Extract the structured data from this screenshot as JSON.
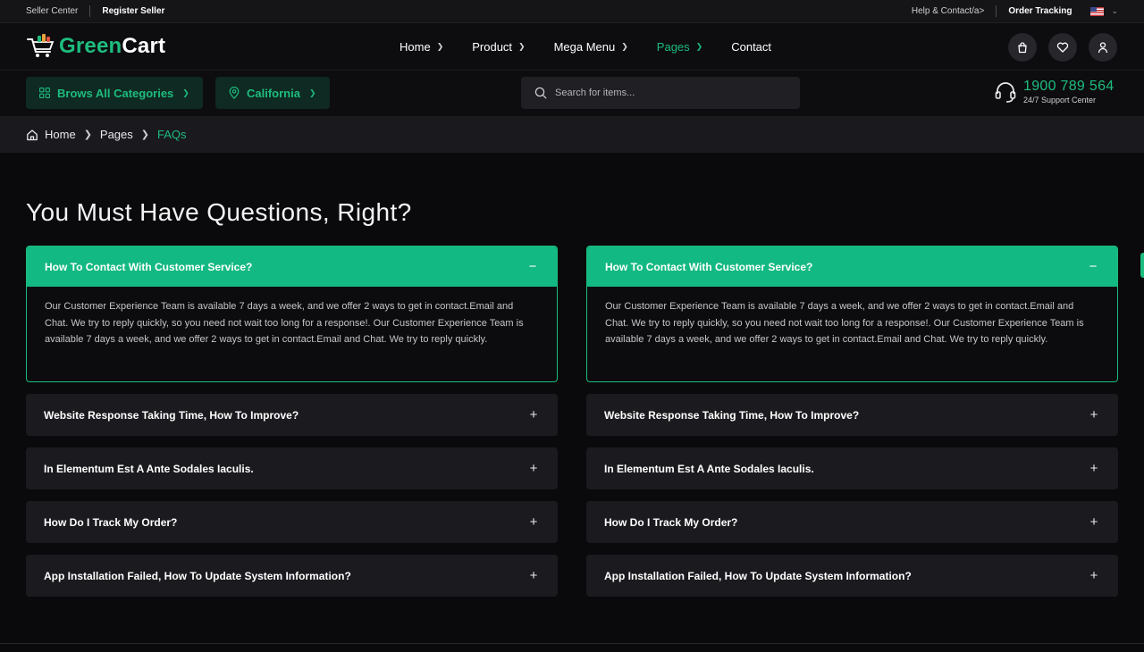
{
  "topbar": {
    "seller_center": "Seller Center",
    "register_seller": "Register Seller",
    "help_contact": "Help & Contact/a>",
    "order_tracking": "Order Tracking",
    "language_flag": "us-flag-icon"
  },
  "brand": {
    "logo_green": "Green",
    "logo_white": "Cart",
    "accent_color": "#1ebc7e"
  },
  "nav": {
    "items": [
      {
        "label": "Home",
        "has_dropdown": true,
        "active": false
      },
      {
        "label": "Product",
        "has_dropdown": true,
        "active": false
      },
      {
        "label": "Mega Menu",
        "has_dropdown": true,
        "active": false
      },
      {
        "label": "Pages",
        "has_dropdown": true,
        "active": true
      },
      {
        "label": "Contact",
        "has_dropdown": false,
        "active": false
      }
    ]
  },
  "header_icons": [
    "cart-icon",
    "heart-icon",
    "user-icon"
  ],
  "catbar": {
    "categories_label": "Brows All Categories",
    "location_label": "California",
    "search_placeholder": "Search for items...",
    "support_number": "1900 789 564",
    "support_label": "24/7 Support Center"
  },
  "breadcrumb": {
    "home": "Home",
    "pages": "Pages",
    "current": "FAQs"
  },
  "main": {
    "title": "You Must Have Questions, Right?",
    "columns": [
      {
        "open_item": {
          "question": "How To Contact With Customer Service?",
          "answer": "Our Customer Experience Team is available 7 days a week, and we offer 2 ways to get in contact.Email and Chat. We try to reply quickly, so you need not wait too long for a response!. Our Customer Experience Team is available 7 days a week, and we offer 2 ways to get in contact.Email and Chat. We try to reply quickly.",
          "toggle": "−"
        },
        "items": [
          {
            "question": "Website Response Taking Time, How To Improve?",
            "toggle": "+"
          },
          {
            "question": "In Elementum Est A Ante Sodales Iaculis.",
            "toggle": "+"
          },
          {
            "question": "How Do I Track My Order?",
            "toggle": "+"
          },
          {
            "question": "App Installation Failed, How To Update System Information?",
            "toggle": "+"
          }
        ]
      },
      {
        "open_item": {
          "question": "How To Contact With Customer Service?",
          "answer": "Our Customer Experience Team is available 7 days a week, and we offer 2 ways to get in contact.Email and Chat. We try to reply quickly, so you need not wait too long for a response!. Our Customer Experience Team is available 7 days a week, and we offer 2 ways to get in contact.Email and Chat. We try to reply quickly.",
          "toggle": "−"
        },
        "items": [
          {
            "question": "Website Response Taking Time, How To Improve?",
            "toggle": "+"
          },
          {
            "question": "In Elementum Est A Ante Sodales Iaculis.",
            "toggle": "+"
          },
          {
            "question": "How Do I Track My Order?",
            "toggle": "+"
          },
          {
            "question": "App Installation Failed, How To Update System Information?",
            "toggle": "+"
          }
        ]
      }
    ]
  }
}
